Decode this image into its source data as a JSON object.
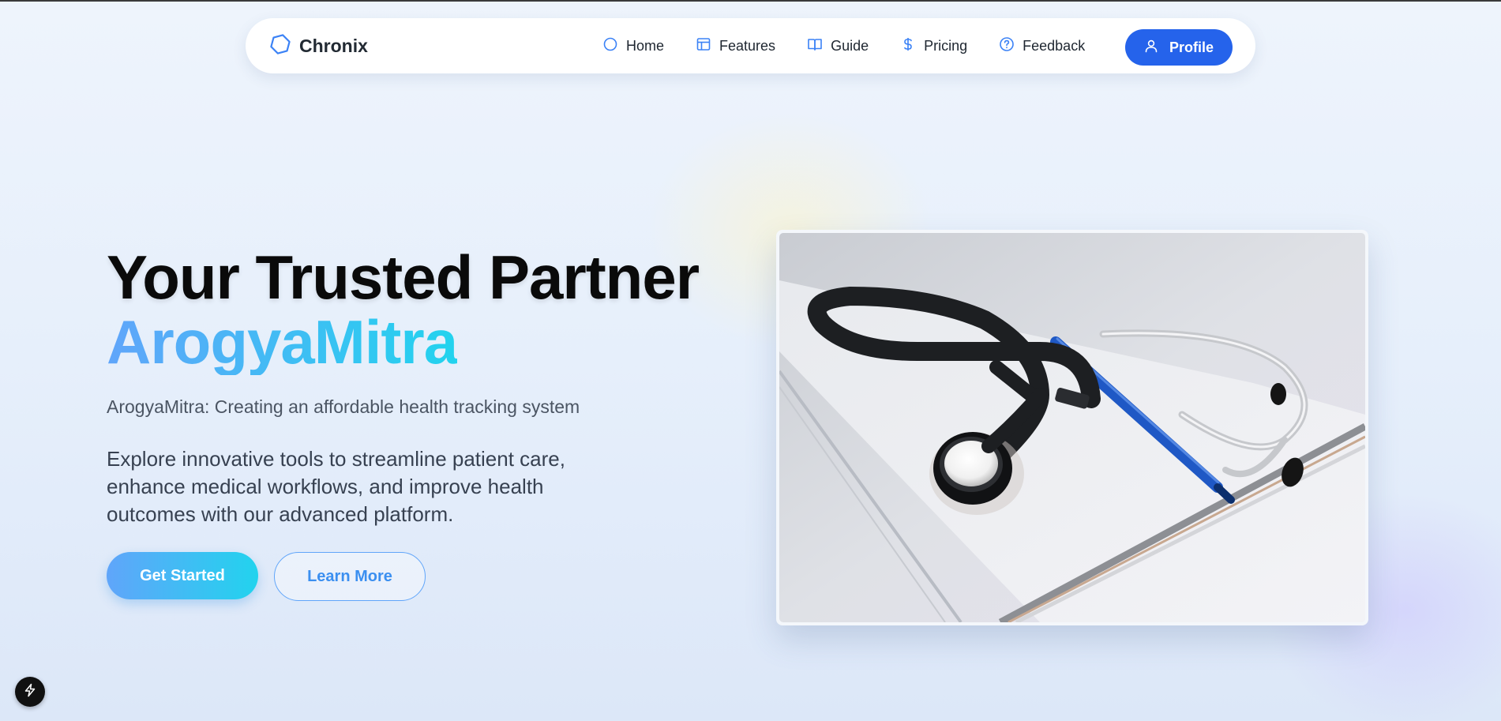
{
  "brand": {
    "name": "Chronix",
    "icon": "hexagon-logo-icon"
  },
  "nav": {
    "items": [
      {
        "label": "Home",
        "icon": "circle-icon"
      },
      {
        "label": "Features",
        "icon": "layout-icon"
      },
      {
        "label": "Guide",
        "icon": "book-icon"
      },
      {
        "label": "Pricing",
        "icon": "dollar-icon"
      },
      {
        "label": "Feedback",
        "icon": "help-circle-icon"
      }
    ],
    "profile_label": "Profile",
    "profile_icon": "user-icon"
  },
  "hero": {
    "title": "Your Trusted Partner",
    "title_accent": "ArogyaMitra",
    "subtitle": "ArogyaMitra: Creating an affordable health tracking system",
    "description": "Explore innovative tools to streamline patient care, enhance medical workflows, and improve health outcomes with our advanced platform.",
    "primary_button": "Get Started",
    "secondary_button": "Learn More"
  },
  "colors": {
    "accent_blue": "#2563eb",
    "gradient_start": "#60a5fa",
    "gradient_end": "#22d3ee",
    "icon_blue": "#3b82f6"
  },
  "dev_badge_icon": "lightning-icon"
}
